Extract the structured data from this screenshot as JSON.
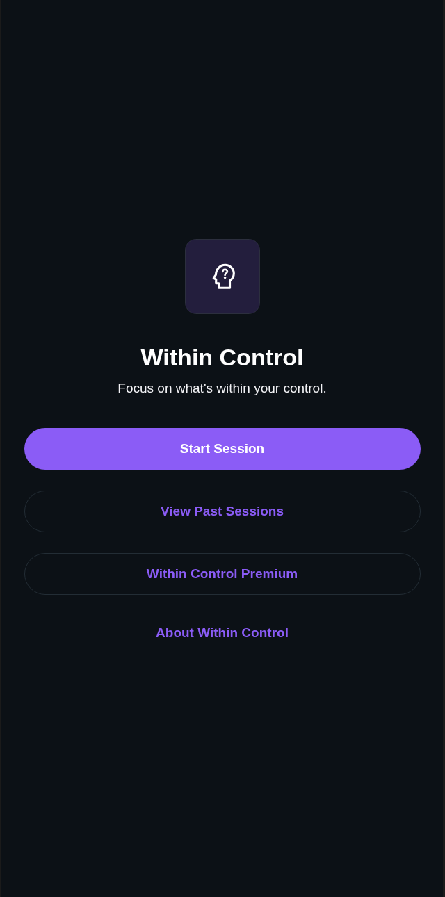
{
  "app": {
    "title": "Within Control",
    "tagline": "Focus on what's within your control."
  },
  "actions": [
    {
      "label": "Start Session",
      "kind": "primary"
    },
    {
      "label": "View Past Sessions",
      "kind": "outlined"
    },
    {
      "label": "Within Control Premium",
      "kind": "outlined"
    },
    {
      "label": "About Within Control",
      "kind": "text"
    }
  ]
}
